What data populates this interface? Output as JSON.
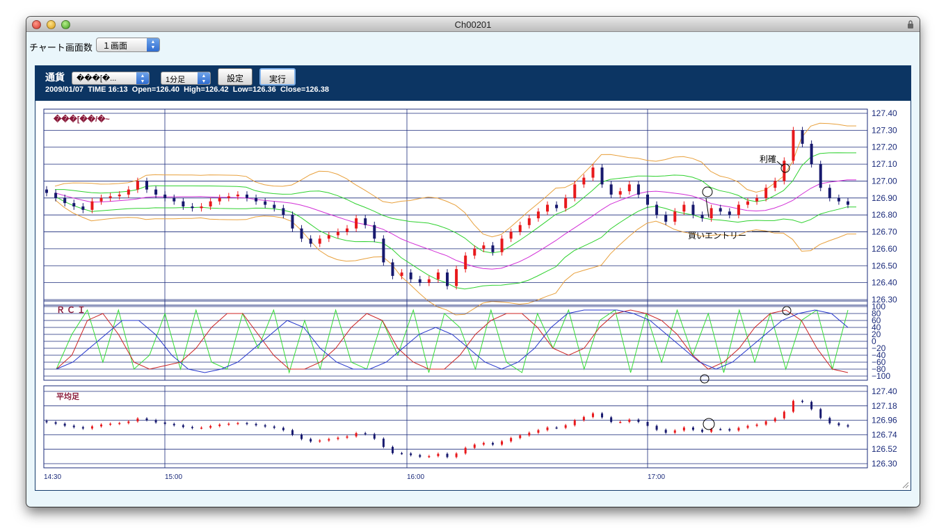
{
  "window": {
    "title": "Ch00201"
  },
  "toolbar": {
    "chart_count_label": "チャート画面数",
    "chart_count_value": "１画面"
  },
  "header": {
    "currency_label": "通貨",
    "currency_value": "���[�...",
    "timeframe_value": "1分足",
    "settings_button": "設定",
    "run_button": "実行",
    "date": "2009/01/07",
    "time": "TIME 16:13",
    "open": "Open=126.40",
    "high": "High=126.42",
    "low": "Low=126.36",
    "close": "Close=126.38"
  },
  "colors": {
    "header_bg": "#0c3563",
    "grid": "#1a2a7a",
    "up": "#e8191c",
    "down": "#17196e",
    "bb_outer": "#e8a03c",
    "bb_inner": "#2ed12e",
    "ma": "#d12ed6",
    "rci_short": "#33dd33",
    "rci_mid": "#cc2222",
    "rci_long": "#2233cc",
    "label": "#8a1a3a"
  },
  "chart_data": [
    {
      "type": "candlestick",
      "panel": "price",
      "title": "���[��/�~",
      "ylim": [
        126.3,
        127.4
      ],
      "y_ticks": [
        "127.40",
        "127.30",
        "127.20",
        "127.10",
        "127.00",
        "126.90",
        "126.80",
        "126.70",
        "126.60",
        "126.50",
        "126.40",
        "126.30"
      ],
      "x_ticks": [
        "14:30",
        "15:00",
        "16:00",
        "17:00"
      ],
      "annotations": [
        "利確",
        "買いエントリー"
      ],
      "close_series_approx": [
        126.93,
        126.9,
        126.87,
        126.85,
        126.83,
        126.88,
        126.9,
        126.91,
        126.92,
        126.95,
        127.0,
        126.95,
        126.92,
        126.9,
        126.88,
        126.85,
        126.84,
        126.85,
        126.88,
        126.9,
        126.91,
        126.92,
        126.9,
        126.88,
        126.86,
        126.84,
        126.8,
        126.72,
        126.66,
        126.63,
        126.66,
        126.68,
        126.7,
        126.72,
        126.78,
        126.74,
        126.66,
        126.52,
        126.44,
        126.46,
        126.42,
        126.4,
        126.42,
        126.46,
        126.38,
        126.48,
        126.56,
        126.6,
        126.62,
        126.58,
        126.66,
        126.7,
        126.74,
        126.78,
        126.82,
        126.86,
        126.84,
        126.9,
        126.98,
        127.02,
        127.08,
        126.98,
        126.92,
        126.94,
        126.98,
        126.92,
        126.86,
        126.8,
        126.76,
        126.82,
        126.86,
        126.8,
        126.78,
        126.84,
        126.82,
        126.8,
        126.86,
        126.88,
        126.9,
        126.96,
        127.0,
        127.12,
        127.3,
        127.22,
        127.1,
        126.96,
        126.9,
        126.88,
        126.86
      ]
    },
    {
      "type": "line",
      "panel": "rci",
      "title": "ＲＣＩ",
      "ylim": [
        -100,
        100
      ],
      "y_ticks": [
        "100",
        "80",
        "60",
        "40",
        "20",
        "0",
        "−20",
        "−40",
        "−60",
        "−80",
        "−100"
      ],
      "series": [
        {
          "values_approx": [
            -80,
            20,
            90,
            -60,
            90,
            -80,
            -40,
            80,
            -80,
            90,
            -60,
            -80,
            80,
            -20,
            90,
            -90,
            60,
            -80,
            90,
            -60,
            -80,
            60,
            -40,
            90,
            -90,
            80,
            40,
            -80,
            90,
            -60,
            -90,
            80,
            -20,
            90,
            -80,
            60,
            90,
            -90,
            80,
            -60,
            90,
            -40,
            80,
            -90,
            90,
            -60,
            80,
            -80,
            60,
            90,
            -80,
            90
          ]
        },
        {
          "values_approx": [
            -80,
            -40,
            60,
            80,
            20,
            -60,
            -80,
            -70,
            -60,
            -20,
            40,
            80,
            80,
            20,
            -40,
            -80,
            -80,
            -60,
            -20,
            40,
            80,
            60,
            -20,
            -60,
            -80,
            -80,
            -40,
            20,
            60,
            80,
            80,
            40,
            -20,
            -40,
            -20,
            40,
            80,
            90,
            80,
            60,
            20,
            -40,
            -80,
            -60,
            -20,
            40,
            80,
            90,
            60,
            -20,
            -80,
            -90
          ]
        },
        {
          "values_approx": [
            -80,
            -60,
            -20,
            20,
            60,
            60,
            20,
            -40,
            -80,
            -90,
            -80,
            -60,
            -20,
            20,
            60,
            40,
            -20,
            -60,
            -80,
            -80,
            -60,
            -20,
            20,
            40,
            20,
            -20,
            -60,
            -80,
            -60,
            -20,
            40,
            80,
            90,
            90,
            90,
            80,
            60,
            20,
            -20,
            -60,
            -80,
            -60,
            -20,
            20,
            60,
            80,
            90,
            80,
            40
          ]
        }
      ]
    },
    {
      "type": "candlestick",
      "panel": "heikin-ashi",
      "title": "平均足",
      "ylim": [
        126.3,
        127.4
      ],
      "y_ticks": [
        "127.40",
        "127.18",
        "126.96",
        "126.74",
        "126.52",
        "126.30"
      ]
    }
  ]
}
